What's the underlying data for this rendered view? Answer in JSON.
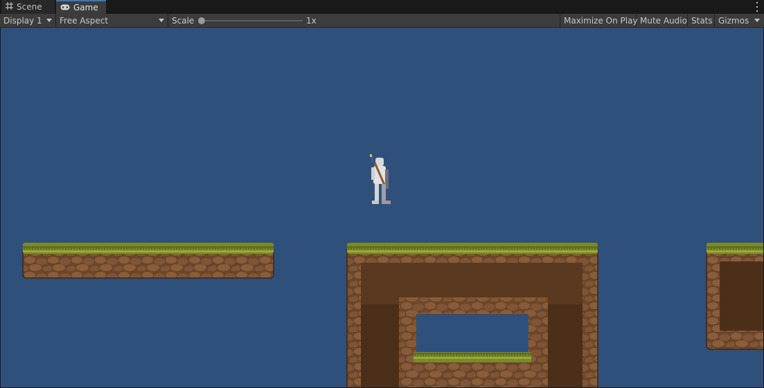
{
  "tabs": [
    {
      "label": "Scene",
      "icon": "grid-icon",
      "active": false
    },
    {
      "label": "Game",
      "icon": "gamepad-icon",
      "active": true
    }
  ],
  "toolbar": {
    "display": "Display 1",
    "aspect": "Free Aspect",
    "scale_label": "Scale",
    "scale_value": "1x",
    "maximize_on_play": "Maximize On Play",
    "mute_audio": "Mute Audio",
    "stats": "Stats",
    "gizmos": "Gizmos"
  },
  "colors": {
    "sky": "#30507c",
    "grass": "#7d8c2a",
    "dirt_light": "#7a5234",
    "dirt_dark": "#4a2f1a",
    "tab_accent": "#3a79bb"
  }
}
